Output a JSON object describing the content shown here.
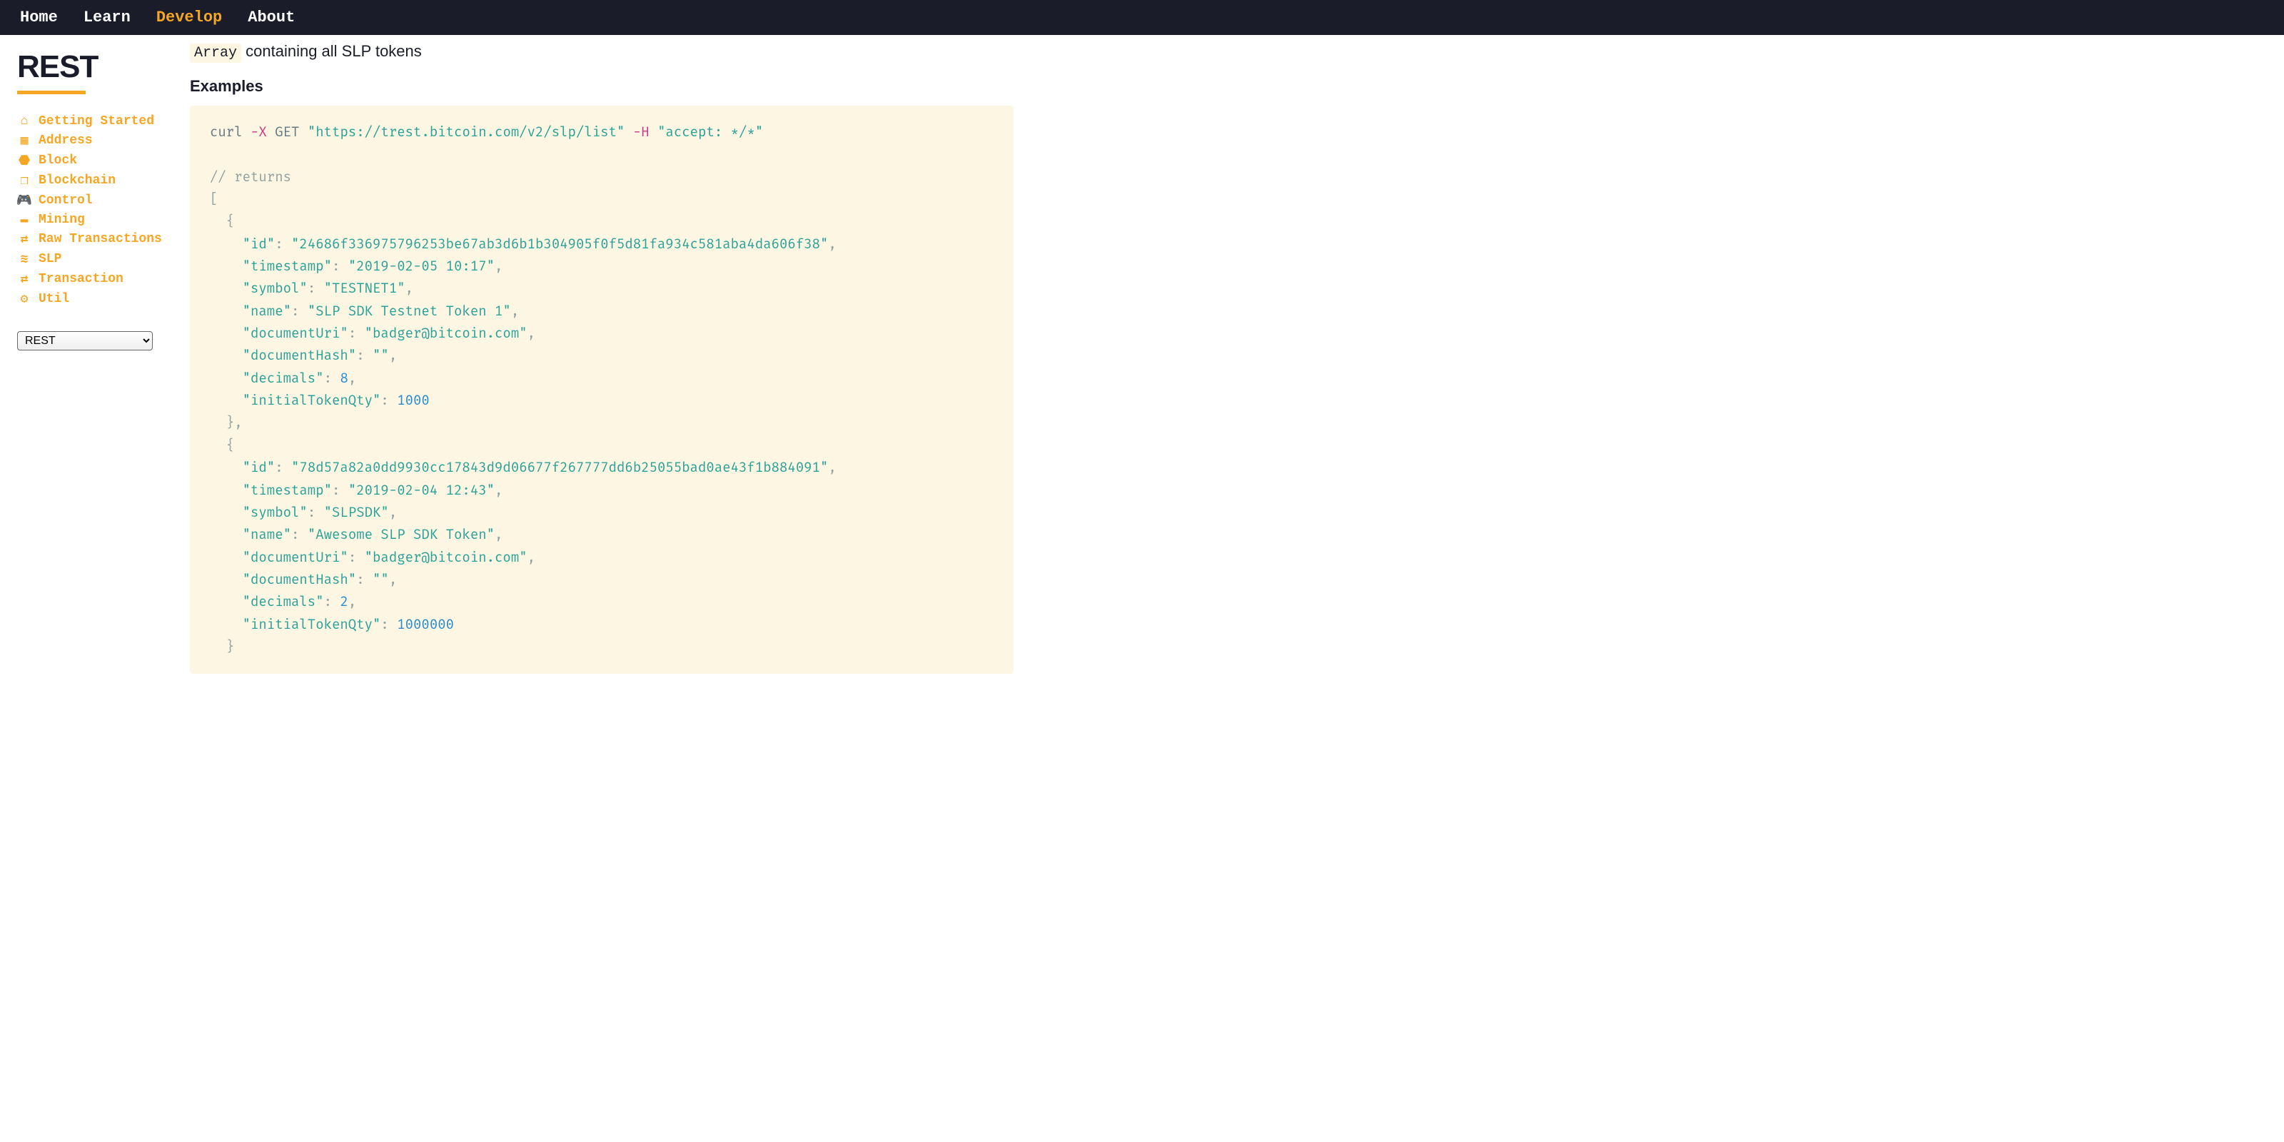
{
  "topnav": {
    "items": [
      {
        "label": "Home",
        "active": false
      },
      {
        "label": "Learn",
        "active": false
      },
      {
        "label": "Develop",
        "active": true
      },
      {
        "label": "About",
        "active": false
      }
    ]
  },
  "sidebar": {
    "title": "REST",
    "items": [
      {
        "icon": "home-icon",
        "label": "Getting Started"
      },
      {
        "icon": "qr-icon",
        "label": "Address"
      },
      {
        "icon": "cube-icon",
        "label": "Block"
      },
      {
        "icon": "cubes-icon",
        "label": "Blockchain"
      },
      {
        "icon": "gamepad-icon",
        "label": "Control"
      },
      {
        "icon": "hdd-icon",
        "label": "Mining"
      },
      {
        "icon": "exchange-icon",
        "label": "Raw Transactions"
      },
      {
        "icon": "coins-icon",
        "label": "SLP"
      },
      {
        "icon": "exchange-icon",
        "label": "Transaction"
      },
      {
        "icon": "cogs-icon",
        "label": "Util"
      }
    ],
    "select_value": "REST"
  },
  "main": {
    "intro_code": "Array",
    "intro_text": " containing all SLP tokens",
    "examples_heading": "Examples",
    "code": {
      "curl_cmd": "curl",
      "curl_flag1": "-X",
      "curl_method": "GET",
      "curl_url": "\"https://trest.bitcoin.com/v2/slp/list\"",
      "curl_flag2": "-H",
      "curl_header": "\"accept: */*\"",
      "returns_comment": "// returns",
      "tokens": [
        {
          "id": "\"24686f336975796253be67ab3d6b1b304905f0f5d81fa934c581aba4da606f38\"",
          "timestamp": "\"2019-02-05 10:17\"",
          "symbol": "\"TESTNET1\"",
          "name": "\"SLP SDK Testnet Token 1\"",
          "documentUri": "\"badger@bitcoin.com\"",
          "documentHash": "\"\"",
          "decimals": "8",
          "initialTokenQty": "1000"
        },
        {
          "id": "\"78d57a82a0dd9930cc17843d9d06677f267777dd6b25055bad0ae43f1b884091\"",
          "timestamp": "\"2019-02-04 12:43\"",
          "symbol": "\"SLPSDK\"",
          "name": "\"Awesome SLP SDK Token\"",
          "documentUri": "\"badger@bitcoin.com\"",
          "documentHash": "\"\"",
          "decimals": "2",
          "initialTokenQty": "1000000"
        }
      ]
    }
  },
  "icons": {
    "home-icon": "⌂",
    "qr-icon": "▦",
    "cube-icon": "⬣",
    "cubes-icon": "❒",
    "gamepad-icon": "🎮",
    "hdd-icon": "▬",
    "exchange-icon": "⇄",
    "coins-icon": "≋",
    "cogs-icon": "⚙"
  }
}
